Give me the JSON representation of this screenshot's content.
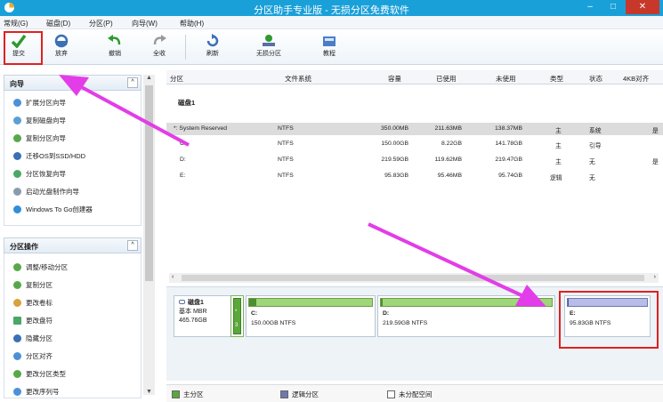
{
  "window": {
    "title": "分区助手专业版 - 无损分区免费软件",
    "close_glyph": "✕",
    "min_glyph": "–",
    "max_glyph": "□"
  },
  "menu": [
    "常规(G)",
    "磁盘(D)",
    "分区(P)",
    "向导(W)",
    "帮助(H)"
  ],
  "toolbar": {
    "commit": "提交",
    "undo": "放弃",
    "redo": "撤销",
    "refresh_all": "全收",
    "refresh": "刷新",
    "lossless": "无损分区",
    "tutorial": "教程"
  },
  "sidebar": {
    "wizard_title": "向导",
    "wizard_items": [
      "扩展分区向导",
      "复制磁盘向导",
      "复制分区向导",
      "迁移OS到SSD/HDD",
      "分区恢复向导",
      "启动光盘制作向导",
      "Windows To Go创建器"
    ],
    "ops_title": "分区操作",
    "ops_items": [
      "调整/移动分区",
      "复制分区",
      "更改卷标",
      "更改盘符",
      "隐藏分区",
      "分区对齐",
      "更改分区类型",
      "更改序列号"
    ],
    "collapse_glyph": "^"
  },
  "grid": {
    "headers": [
      "分区",
      "文件系统",
      "容量",
      "已使用",
      "未使用",
      "类型",
      "状态",
      "4KB对齐"
    ],
    "disk_label": "磁盘1",
    "rows": [
      {
        "name": "*: System Reserved",
        "fs": "NTFS",
        "cap": "350.00MB",
        "used": "211.63MB",
        "free": "138.37MB",
        "type": "主",
        "status": "系统",
        "align": "是"
      },
      {
        "name": "C:",
        "fs": "NTFS",
        "cap": "150.00GB",
        "used": "8.22GB",
        "free": "141.78GB",
        "type": "主",
        "status": "引导",
        "align": ""
      },
      {
        "name": "D:",
        "fs": "NTFS",
        "cap": "219.59GB",
        "used": "119.62MB",
        "free": "219.47GB",
        "type": "主",
        "status": "无",
        "align": "是"
      },
      {
        "name": "E:",
        "fs": "NTFS",
        "cap": "95.83GB",
        "used": "95.46MB",
        "free": "95.74GB",
        "type": "逻辑",
        "status": "无",
        "align": ""
      }
    ]
  },
  "diskmap": {
    "disk_name": "磁盘1",
    "disk_type": "基本 MBR",
    "disk_size": "465.76GB",
    "sys_mark": "*",
    "sys_num": "3",
    "parts": [
      {
        "name": "C:",
        "info": "150.00GB NTFS",
        "used_fraction": 0.055
      },
      {
        "name": "D:",
        "info": "219.59GB NTFS",
        "used_fraction": 0.01
      },
      {
        "name": "E:",
        "info": "95.83GB NTFS",
        "used_fraction": 0.01
      }
    ]
  },
  "legend": {
    "primary": "主分区",
    "logical": "逻辑分区",
    "unalloc": "未分配空间"
  },
  "colors": {
    "titlebar": "#1aa0d9",
    "primary": "#5aa83a",
    "logical": "#6e78b2",
    "highlight": "#e02020",
    "arrow": "#e23de8"
  }
}
